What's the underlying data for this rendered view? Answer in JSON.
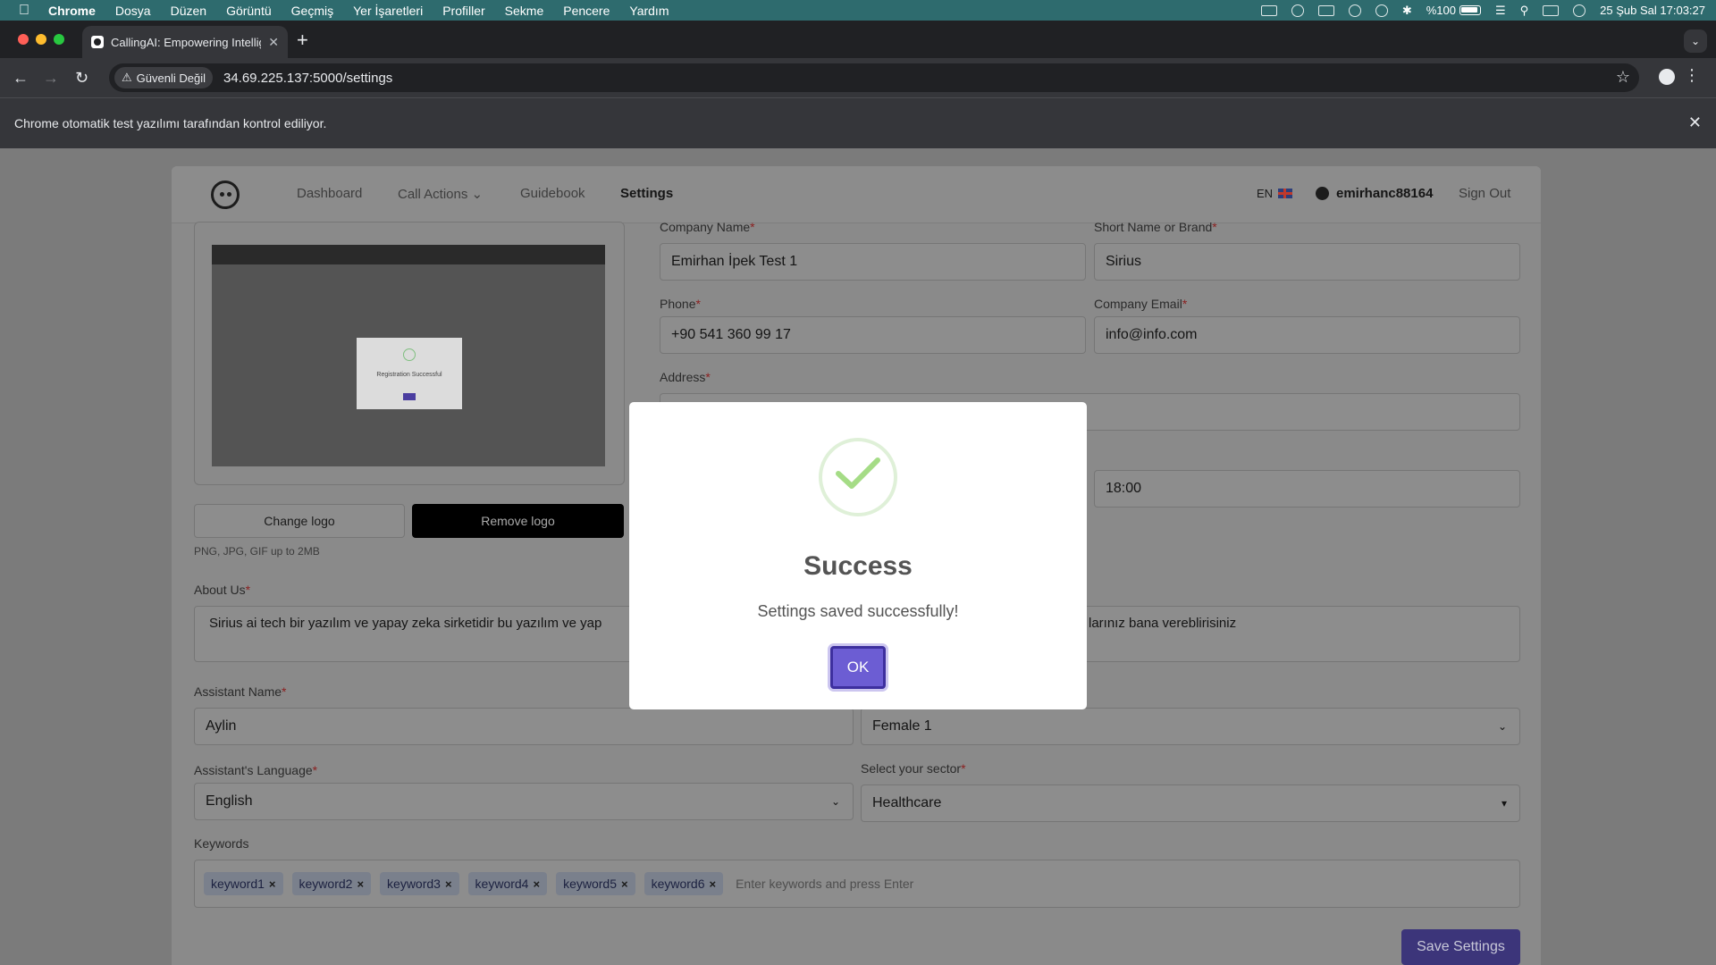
{
  "menubar": {
    "apple_icon": "apple-logo",
    "items": [
      "Chrome",
      "Dosya",
      "Düzen",
      "Görüntü",
      "Geçmiş",
      "Yer İşaretleri",
      "Profiller",
      "Sekme",
      "Pencere",
      "Yardım"
    ],
    "battery": "%100",
    "datetime": "25 Şub Sal 17:03:27"
  },
  "browser": {
    "tab_title": "CallingAI: Empowering Intellig",
    "security_label": "Güvenli Değil",
    "url": "34.69.225.137:5000/settings",
    "infobar_message": "Chrome otomatik test yazılımı tarafından kontrol ediliyor."
  },
  "nav": {
    "dashboard": "Dashboard",
    "call_actions": "Call Actions",
    "guidebook": "Guidebook",
    "settings": "Settings",
    "lang": "EN",
    "username": "emirhanc88164",
    "sign_out": "Sign Out"
  },
  "form": {
    "company_name_label": "Company Name",
    "company_name": "Emirhan İpek Test 1",
    "short_name_label": "Short Name or Brand",
    "short_name": "Sirius",
    "phone_label": "Phone",
    "phone": "+90 541 360 99 17",
    "email_label": "Company Email",
    "email": "info@info.com",
    "address_label": "Address",
    "end_time": "18:00",
    "change_logo": "Change logo",
    "remove_logo": "Remove logo",
    "logo_hint": "PNG, JPG, GIF up to 2MB",
    "about_label": "About Us",
    "about_text": "Sirius ai tech bir yazılım ve yapay zeka sirketidir bu yazılım ve yap",
    "about_tail": "larınız bana vereblirisiniz",
    "assistant_name_label": "Assistant Name",
    "assistant_name": "Aylin",
    "voice": "Female 1",
    "language_label": "Assistant's Language",
    "language": "English",
    "sector_label": "Select your sector",
    "sector": "Healthcare",
    "keywords_label": "Keywords",
    "keywords": [
      "keyword1",
      "keyword2",
      "keyword3",
      "keyword4",
      "keyword5",
      "keyword6"
    ],
    "keywords_placeholder": "Enter keywords and press Enter",
    "save_button": "Save Settings",
    "required_mark": "*"
  },
  "logo_preview": {
    "caption": "Registration Successful"
  },
  "modal": {
    "title": "Success",
    "message": "Settings saved successfully!",
    "ok": "OK"
  }
}
